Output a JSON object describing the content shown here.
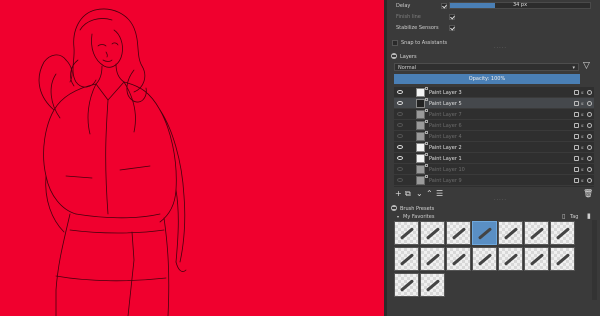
{
  "canvas": {
    "background": "#f0002e"
  },
  "tool_options": {
    "delay_label": "Delay",
    "delay_value": "34 px",
    "delay_fill": 0.32,
    "finish_line_label": "Finish line",
    "stabilize_sensors_label": "Stabilize Sensors",
    "snap_assistants_label": "Snap to Assistants"
  },
  "layers_panel": {
    "title": "Layers",
    "blend_mode": "Normal",
    "opacity_label": "Opacity: 100%",
    "layers": [
      {
        "name": "Paint Layer 3",
        "visible": true,
        "selected": false,
        "thumb": "white"
      },
      {
        "name": "Paint Layer 5",
        "visible": true,
        "selected": true,
        "thumb": "dark"
      },
      {
        "name": "Paint Layer 7",
        "visible": false,
        "selected": false,
        "thumb": "grey"
      },
      {
        "name": "Paint Layer 6",
        "visible": false,
        "selected": false,
        "thumb": "grey"
      },
      {
        "name": "Paint Layer 4",
        "visible": false,
        "selected": false,
        "thumb": "grey"
      },
      {
        "name": "Paint Layer 2",
        "visible": true,
        "selected": false,
        "thumb": "white"
      },
      {
        "name": "Paint Layer 1",
        "visible": true,
        "selected": false,
        "thumb": "white"
      },
      {
        "name": "Paint Layer 10",
        "visible": false,
        "selected": false,
        "thumb": "grey"
      },
      {
        "name": "Paint Layer 9",
        "visible": false,
        "selected": false,
        "thumb": "grey"
      }
    ]
  },
  "brush_presets": {
    "title": "Brush Presets",
    "favorites_label": "My Favorites",
    "tag_label": "Tag"
  },
  "accent_color": "#4a7fb5"
}
